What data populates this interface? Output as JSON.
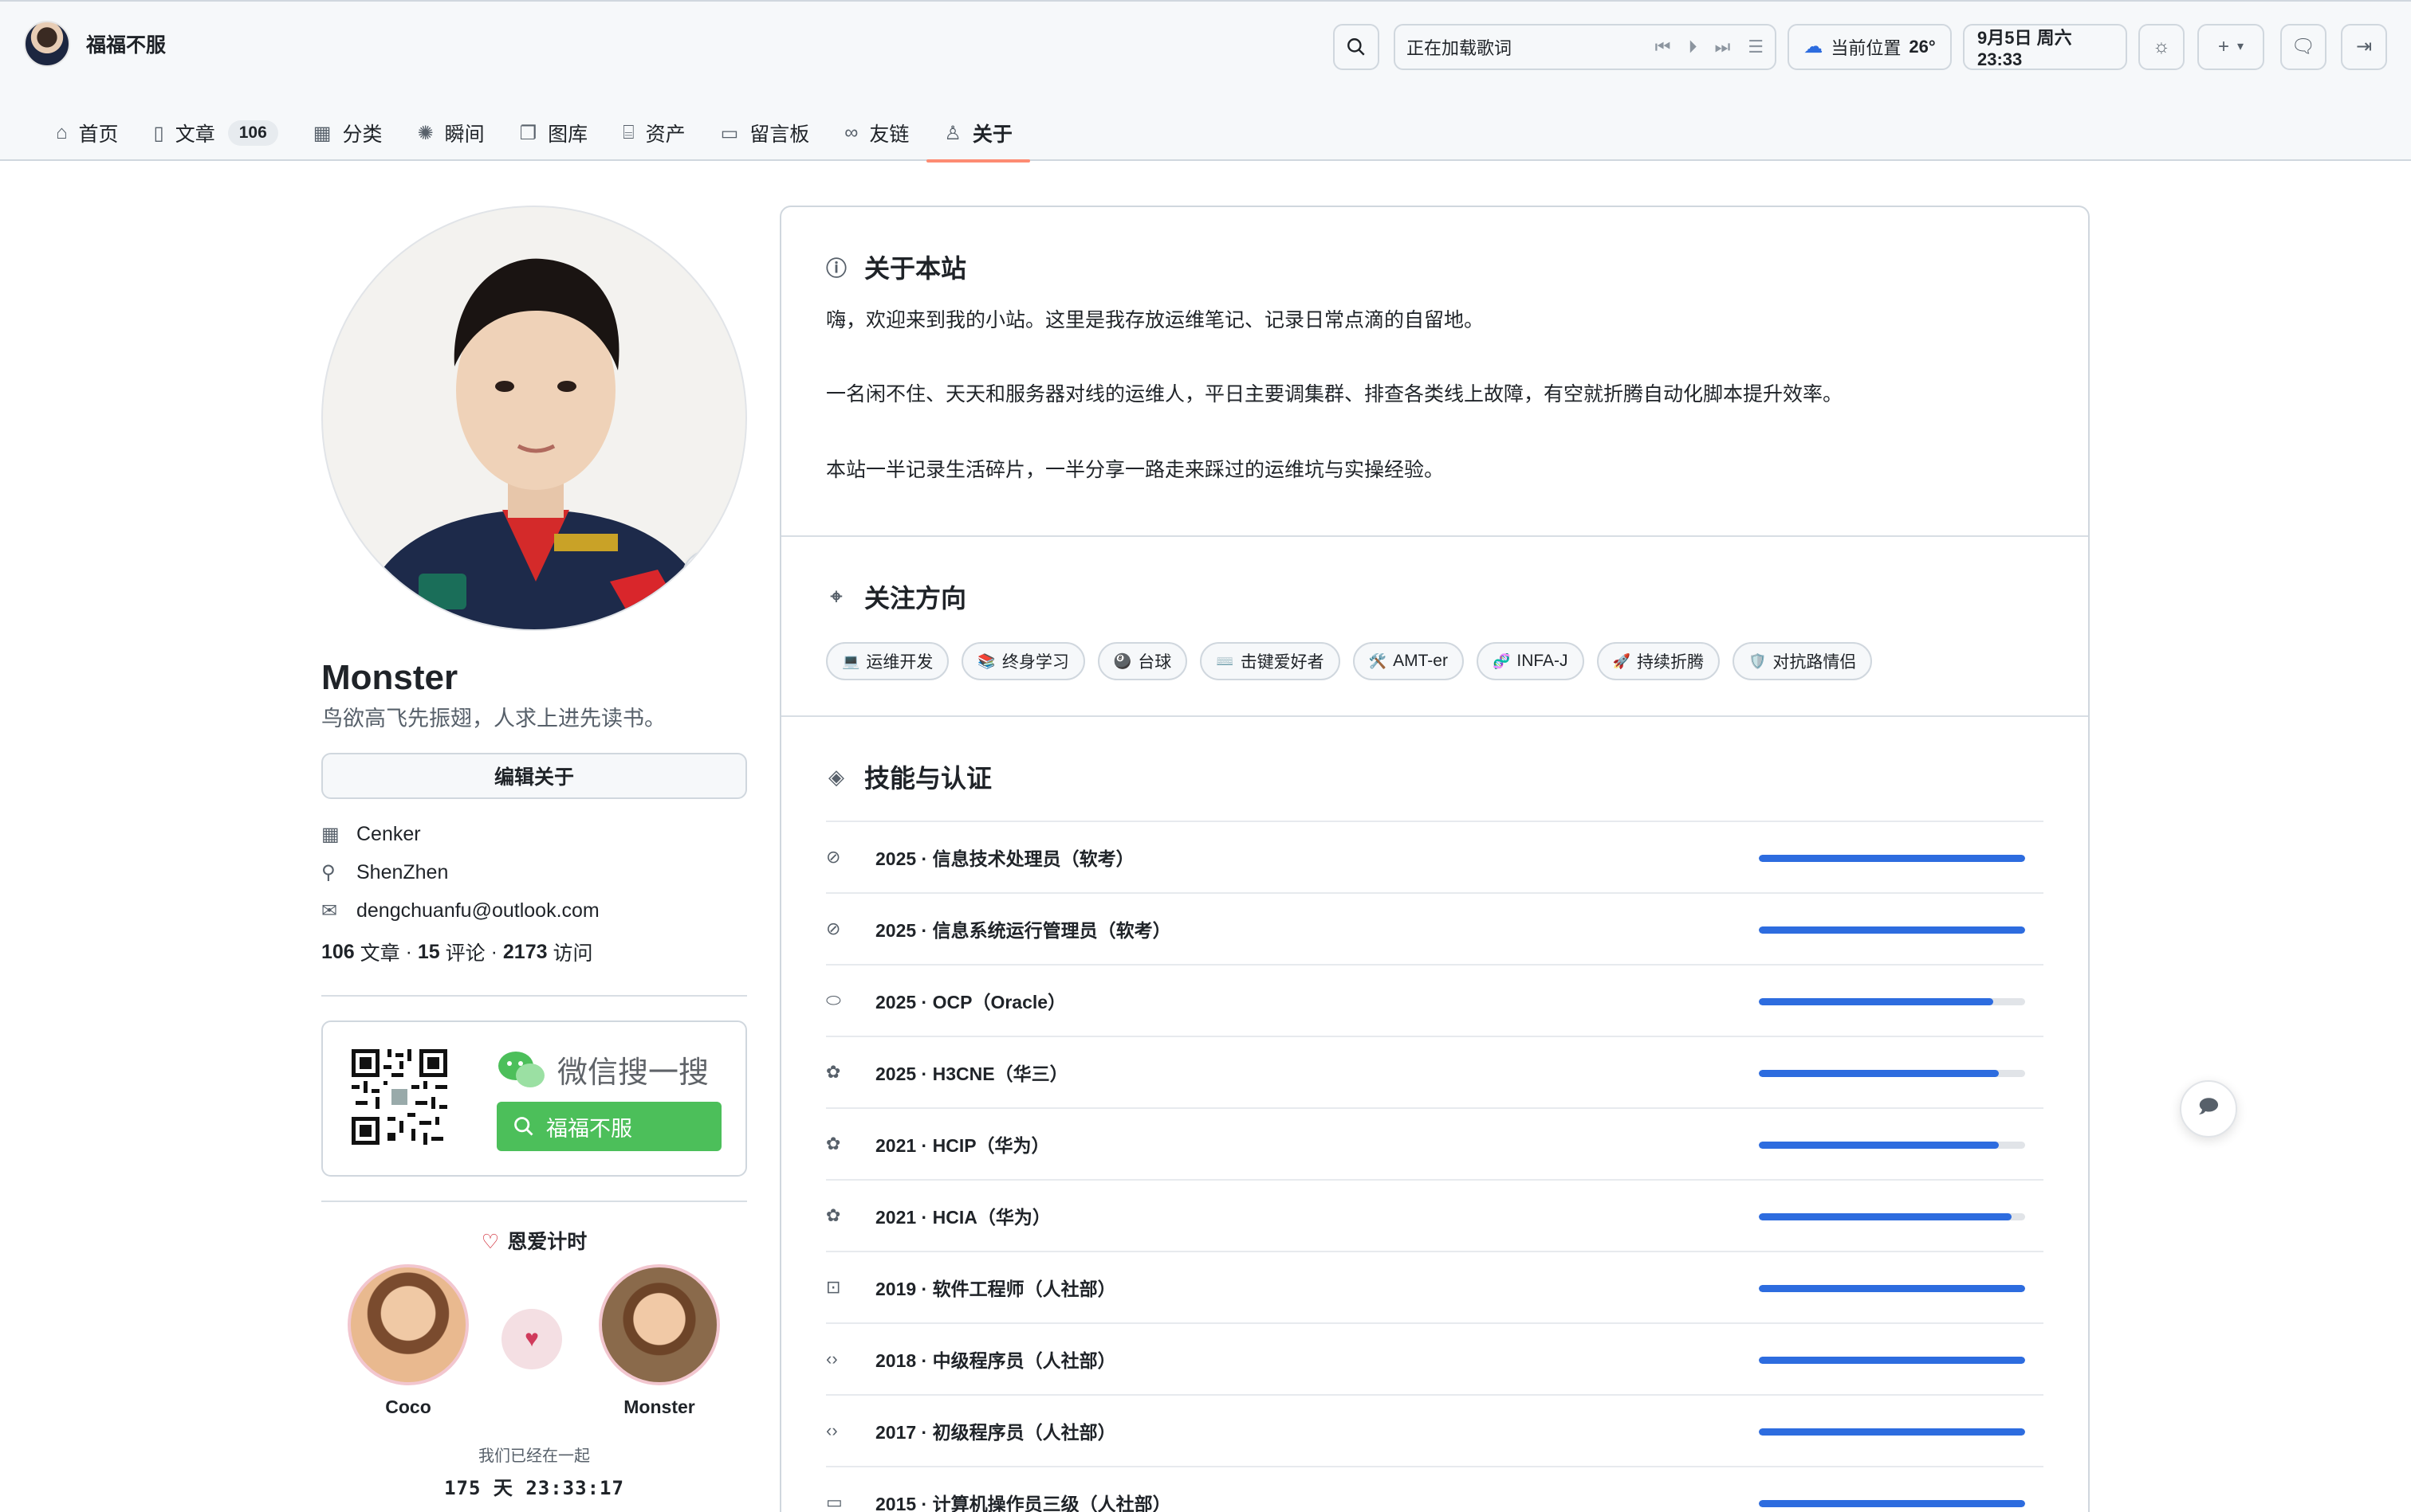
{
  "header": {
    "site_name": "福福不服",
    "lyric": "正在加载歌词",
    "weather_location": "当前位置",
    "weather_temp": "26°",
    "datetime": "9月5日 周六 23:33"
  },
  "nav": [
    {
      "label": "首页",
      "icon": "home-icon"
    },
    {
      "label": "文章",
      "icon": "book-icon",
      "count": "106"
    },
    {
      "label": "分类",
      "icon": "grid-icon"
    },
    {
      "label": "瞬间",
      "icon": "aperture-icon"
    },
    {
      "label": "图库",
      "icon": "images-icon"
    },
    {
      "label": "资产",
      "icon": "briefcase-icon"
    },
    {
      "label": "留言板",
      "icon": "message-icon"
    },
    {
      "label": "友链",
      "icon": "link-icon"
    },
    {
      "label": "关于",
      "icon": "person-icon",
      "active": true
    }
  ],
  "profile": {
    "name": "Monster",
    "motto": "鸟欲高飞先振翅，人求上进先读书。",
    "edit_label": "编辑关于",
    "company": "Cenker",
    "location": "ShenZhen",
    "email": "dengchuanfu@outlook.com",
    "stats": {
      "articles": "106",
      "articles_label": "文章",
      "comments": "15",
      "comments_label": "评论",
      "visits": "2173",
      "visits_label": "访问"
    }
  },
  "wechat": {
    "title": "微信搜一搜",
    "search_text": "福福不服"
  },
  "love": {
    "title": "恩爱计时",
    "left_name": "Coco",
    "right_name": "Monster",
    "together_label": "我们已经在一起",
    "timer": "175 天 23:33:17"
  },
  "about": {
    "title": "关于本站",
    "p1": "嗨，欢迎来到我的小站。这里是我存放运维笔记、记录日常点滴的自留地。",
    "p2": "一名闲不住、天天和服务器对线的运维人，平日主要调集群、排查各类线上故障，有空就折腾自动化脚本提升效率。",
    "p3": "本站一半记录生活碎片，一半分享一路走来踩过的运维坑与实操经验。"
  },
  "focus": {
    "title": "关注方向",
    "tags": [
      {
        "emoji": "💻",
        "label": "运维开发"
      },
      {
        "emoji": "📚",
        "label": "终身学习"
      },
      {
        "emoji": "🎱",
        "label": "台球"
      },
      {
        "emoji": "⌨️",
        "label": "击键爱好者"
      },
      {
        "emoji": "🛠️",
        "label": "AMT-er"
      },
      {
        "emoji": "🧬",
        "label": "INFA-J"
      },
      {
        "emoji": "🚀",
        "label": "持续折腾"
      },
      {
        "emoji": "🛡️",
        "label": "对抗路情侣"
      }
    ]
  },
  "skills": {
    "title": "技能与认证",
    "items": [
      {
        "icon": "check-circle-icon",
        "label": "2025 · 信息技术处理员（软考）",
        "progress": 1.0
      },
      {
        "icon": "check-circle-icon",
        "label": "2025 · 信息系统运行管理员（软考）",
        "progress": 1.0
      },
      {
        "icon": "oracle-icon",
        "label": "2025 · OCP（Oracle）",
        "progress": 0.88
      },
      {
        "icon": "huawei-icon",
        "label": "2025 · H3CNE（华三）",
        "progress": 0.9
      },
      {
        "icon": "huawei-icon",
        "label": "2021 · HCIP（华为）",
        "progress": 0.9
      },
      {
        "icon": "huawei-icon",
        "label": "2021 · HCIA（华为）",
        "progress": 0.95
      },
      {
        "icon": "terminal-icon",
        "label": "2019 · 软件工程师（人社部）",
        "progress": 1.0
      },
      {
        "icon": "code-icon",
        "label": "2018 · 中级程序员（人社部）",
        "progress": 1.0
      },
      {
        "icon": "code-icon",
        "label": "2017 · 初级程序员（人社部）",
        "progress": 1.0
      },
      {
        "icon": "monitor-icon",
        "label": "2015 · 计算机操作员三级（人社部）",
        "progress": 1.0
      }
    ]
  },
  "colors": {
    "accent": "#2d6cdf",
    "nav_underline": "#fd8c73",
    "wechat_green": "#4cbf5a"
  }
}
